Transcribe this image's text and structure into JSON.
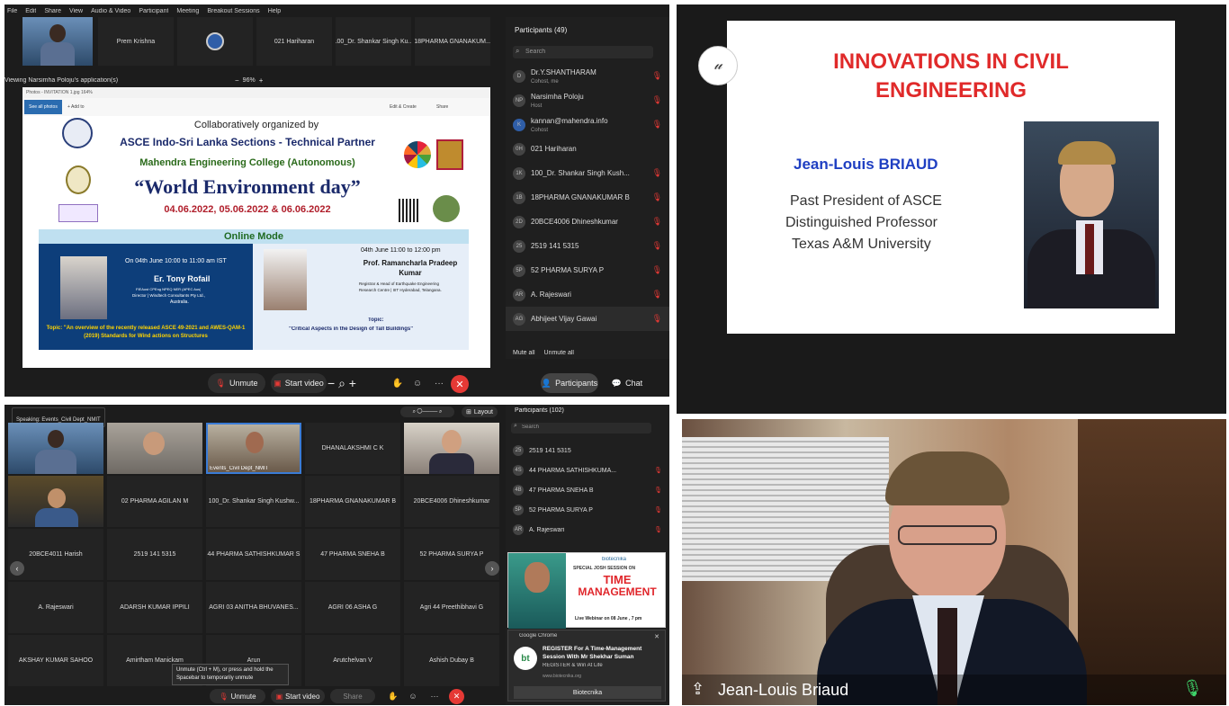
{
  "top_left": {
    "menu": [
      "File",
      "Edit",
      "Share",
      "View",
      "Audio & Video",
      "Participant",
      "Meeting",
      "Breakout Sessions",
      "Help"
    ],
    "strip_tiles": [
      "Prem Krishna",
      "021 Hariharan",
      "100_Dr. Shankar Singh Ku...",
      "18PHARMA GNANAKUM..."
    ],
    "viewing_label": "Viewing Narsimha Poloju's application(s)",
    "zoom": "96%",
    "photos_title": "Photos - INVITATION 1.jpg 164%",
    "photos_toolbar": {
      "see_all": "See all photos",
      "add_to": "+ Add to",
      "edit_create": "Edit & Create",
      "share": "Share"
    },
    "flyer": {
      "line1": "Collaboratively organized by",
      "line2": "ASCE Indo-Sri Lanka Sections - Technical Partner",
      "line3": "Mahendra Engineering College (Autonomous)",
      "line4": "“World Environment day”",
      "dates": "04.06.2022, 05.06.2022 & 06.06.2022",
      "mode": "Online Mode",
      "s1_time": "On 04th June 10:00 to 11:00 am IST",
      "s1_name": "Er. Tony Rofail",
      "s1_det1": "FIEAust CPEng NPEQ NER (APEC Aus)",
      "s1_det2": "Director | Windtech Consultants Pty Ltd.,",
      "s1_det3": "Australia.",
      "s1_topic": "Topic: \"An overview of the recently released ASCE 49-2021 and AWES-QAM-1 (2019) Standards for Wind actions on Structures",
      "s2_time": "04th June 11:00 to 12:00 pm",
      "s2_name": "Prof. Ramancharla Pradeep Kumar",
      "s2_det1": "Registrar & Head of Earthquake Engineering",
      "s2_det2": "Research Centre | IIIT Hyderabad, Telangana.",
      "s2_topic_label": "Topic:",
      "s2_topic": "\"Critical Aspects in the Design of Tall Buildings\""
    },
    "participants_title": "Participants (49)",
    "search_placeholder": "Search",
    "participants": [
      {
        "av": "D",
        "name": "Dr.Y.SHANTHARAM",
        "sub": "Cohost, me"
      },
      {
        "av": "NP",
        "name": "Narsimha Poloju",
        "sub": "Host"
      },
      {
        "av": "K",
        "name": "kannan@mahendra.info",
        "sub": "Cohost"
      },
      {
        "av": "0H",
        "name": "021 Hariharan",
        "sub": ""
      },
      {
        "av": "1K",
        "name": "100_Dr. Shankar Singh Kush...",
        "sub": ""
      },
      {
        "av": "1B",
        "name": "18PHARMA GNANAKUMAR B",
        "sub": ""
      },
      {
        "av": "2D",
        "name": "20BCE4006 Dhineshkumar",
        "sub": ""
      },
      {
        "av": "25",
        "name": "2519 141 5315",
        "sub": ""
      },
      {
        "av": "5P",
        "name": "52 PHARMA SURYA P",
        "sub": ""
      },
      {
        "av": "AR",
        "name": "A. Rajeswari",
        "sub": ""
      },
      {
        "av": "AG",
        "name": "Abhijeet Vijay Gawai",
        "sub": ""
      }
    ],
    "mute_all": "Mute all",
    "unmute_all": "Unmute all",
    "controls": {
      "unmute": "Unmute",
      "start_video": "Start video",
      "participants": "Participants",
      "chat": "Chat"
    }
  },
  "right_top": {
    "title_line1": "INNOVATIONS IN CIVIL",
    "title_line2": "ENGINEERING",
    "name": "Jean-Louis BRIAUD",
    "role1": "Past President of ASCE",
    "role2": "Distinguished Professor",
    "role3": "Texas A&M University"
  },
  "bottom_left": {
    "speaking": "Speaking: Events_Civil Dept_NMIT",
    "layout": "Layout",
    "participants_title": "Participants (102)",
    "search_placeholder": "Search",
    "grid": [
      [
        "",
        "",
        "Events_Civil Dept_NMIT",
        "DHANALAKSHMI C K",
        ""
      ],
      [
        "",
        "02 PHARMA AGILAN M",
        "100_Dr. Shankar Singh Kushw...",
        "18PHARMA GNANAKUMAR B",
        "20BCE4006 Dhineshkumar"
      ],
      [
        "20BCE4011 Harish",
        "2519 141 5315",
        "44 PHARMA SATHISHKUMAR S",
        "47 PHARMA SNEHA B",
        "52 PHARMA SURYA P"
      ],
      [
        "A. Rajeswari",
        "ADARSH KUMAR IPPILI",
        "AGRI 03 ANITHA BHUVANES...",
        "AGRI 06 ASHA G",
        "Agri 44 Preethibhavi G"
      ],
      [
        "AKSHAY KUMAR SAHOO",
        "Amirtham Manickam",
        "Arun",
        "Arutchelvan V",
        "Ashish Dubay B"
      ]
    ],
    "participants": [
      {
        "av": "25",
        "name": "2519 141 5315"
      },
      {
        "av": "4S",
        "name": "44 PHARMA SATHISHKUMA..."
      },
      {
        "av": "4B",
        "name": "47 PHARMA SNEHA B"
      },
      {
        "av": "5P",
        "name": "52 PHARMA SURYA P"
      },
      {
        "av": "AR",
        "name": "A. Rajeswari"
      }
    ],
    "ad": {
      "brand": "biotecnika",
      "special": "SPECIAL JOSH SESSION ON",
      "headline1": "TIME",
      "headline2": "MANAGEMENT",
      "webinar": "Live Webinar on 08 June , 7 pm"
    },
    "notif": {
      "app": "Google Chrome",
      "title": "REGISTER For A Time-Management Session With Mr Shekhar Suman",
      "body": "REGISTER & Win At Life",
      "url": "www.biotecnika.org",
      "button": "Biotecnika",
      "logo": "bt"
    },
    "tooltip": "Unmute (Ctrl + M), or press and hold the Spacebar to temporarily unmute",
    "controls": {
      "unmute": "Unmute",
      "start_video": "Start video",
      "share": "Share"
    }
  },
  "right_bottom": {
    "speaker_name": "Jean-Louis Briaud"
  }
}
